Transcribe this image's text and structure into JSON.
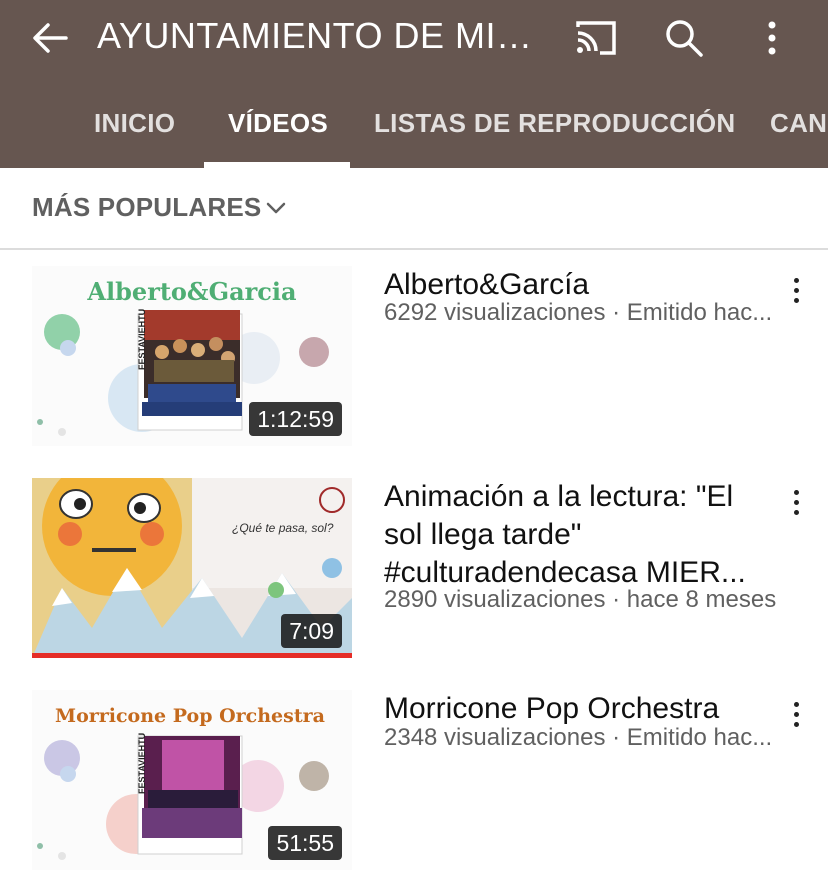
{
  "header": {
    "title": "AYUNTAMIENTO DE MIE...",
    "background": "#665650"
  },
  "tabs": [
    {
      "label": "INICIO"
    },
    {
      "label": "VÍDEOS",
      "active": true
    },
    {
      "label": "LISTAS DE REPRODUCCIÓN"
    },
    {
      "label": "CAN"
    }
  ],
  "filter": {
    "label": "MÁS POPULARES"
  },
  "videos": [
    {
      "title": "Alberto&García",
      "meta": "6292 visualizaciones · Emitido hac...",
      "duration": "1:12:59",
      "thumb_title": "Alberto&Garcia",
      "thumb_side": "FESTAVIEHTU"
    },
    {
      "title": "Animación a la lectura: \"El sol llega tarde\" #culturadendecasa MIER...",
      "meta": "2890 visualizaciones · hace 8 meses",
      "duration": "7:09",
      "thumb_text": "¿Qué te pasa, sol?"
    },
    {
      "title": "Morricone Pop Orchestra",
      "meta": "2348 visualizaciones · Emitido hac...",
      "duration": "51:55",
      "thumb_title": "Morricone Pop Orchestra",
      "thumb_side": "FESTAVIEHTU"
    }
  ],
  "icons": {
    "back": "back-arrow-icon",
    "cast": "cast-icon",
    "search": "search-icon",
    "more": "more-vert-icon",
    "chevron": "chevron-down-icon"
  },
  "colors": {
    "accent_red": "#e52d27",
    "meta_gray": "#606060"
  }
}
